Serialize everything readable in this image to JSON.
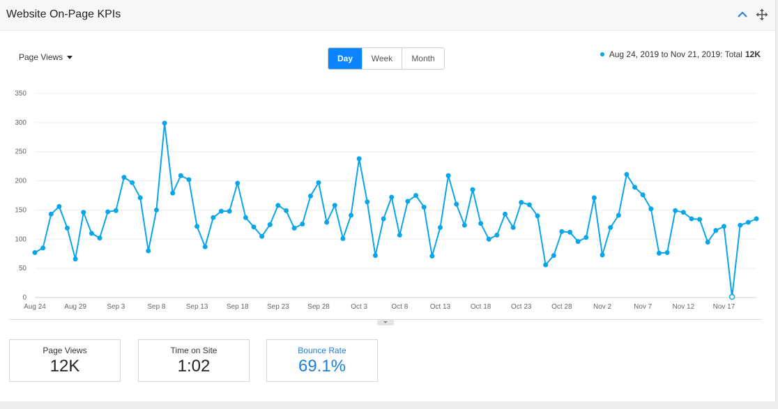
{
  "panel": {
    "title": "Website On-Page KPIs",
    "collapse_icon": "chevron-up-icon",
    "move_icon": "move-arrows-icon"
  },
  "controls": {
    "metric_label": "Page Views",
    "periods": [
      "Day",
      "Week",
      "Month"
    ],
    "active_period": "Day"
  },
  "legend": {
    "range_text": "Aug 24, 2019 to Nov 21, 2019: Total",
    "total": "12K"
  },
  "colors": {
    "accent": "#0a84ff",
    "series": "#0aa5e8",
    "kpi_accent": "#1a7fd9"
  },
  "chart_data": {
    "type": "line",
    "x_tick_labels": [
      "Aug 24",
      "Aug 29",
      "Sep 3",
      "Sep 8",
      "Sep 13",
      "Sep 18",
      "Sep 23",
      "Sep 28",
      "Oct 3",
      "Oct 8",
      "Oct 13",
      "Oct 18",
      "Oct 23",
      "Oct 28",
      "Nov 2",
      "Nov 7",
      "Nov 12",
      "Nov 17"
    ],
    "tick_every_days": 5,
    "y_ticks": [
      0,
      50,
      100,
      150,
      200,
      250,
      300,
      350
    ],
    "ylim": [
      0,
      350
    ],
    "grid": true,
    "series": [
      {
        "values": [
          77,
          85,
          143,
          156,
          119,
          66,
          146,
          110,
          102,
          147,
          149,
          206,
          197,
          171,
          80,
          150,
          299,
          179,
          209,
          202,
          122,
          87,
          137,
          148,
          148,
          196,
          137,
          121,
          105,
          125,
          158,
          149,
          119,
          126,
          174,
          197,
          129,
          158,
          101,
          141,
          238,
          164,
          72,
          135,
          172,
          107,
          165,
          175,
          155,
          71,
          120,
          209,
          160,
          124,
          185,
          127,
          100,
          107,
          143,
          120,
          163,
          159,
          140,
          56,
          72,
          113,
          112,
          96,
          103,
          171,
          73,
          120,
          141,
          211,
          189,
          176,
          152,
          76,
          77,
          149,
          146,
          135,
          134,
          95,
          115,
          122,
          1,
          124,
          129,
          135
        ]
      }
    ]
  },
  "kpis": [
    {
      "label": "Page Views",
      "value": "12K"
    },
    {
      "label": "Time on Site",
      "value": "1:02"
    },
    {
      "label": "Bounce Rate",
      "value": "69.1%"
    }
  ]
}
